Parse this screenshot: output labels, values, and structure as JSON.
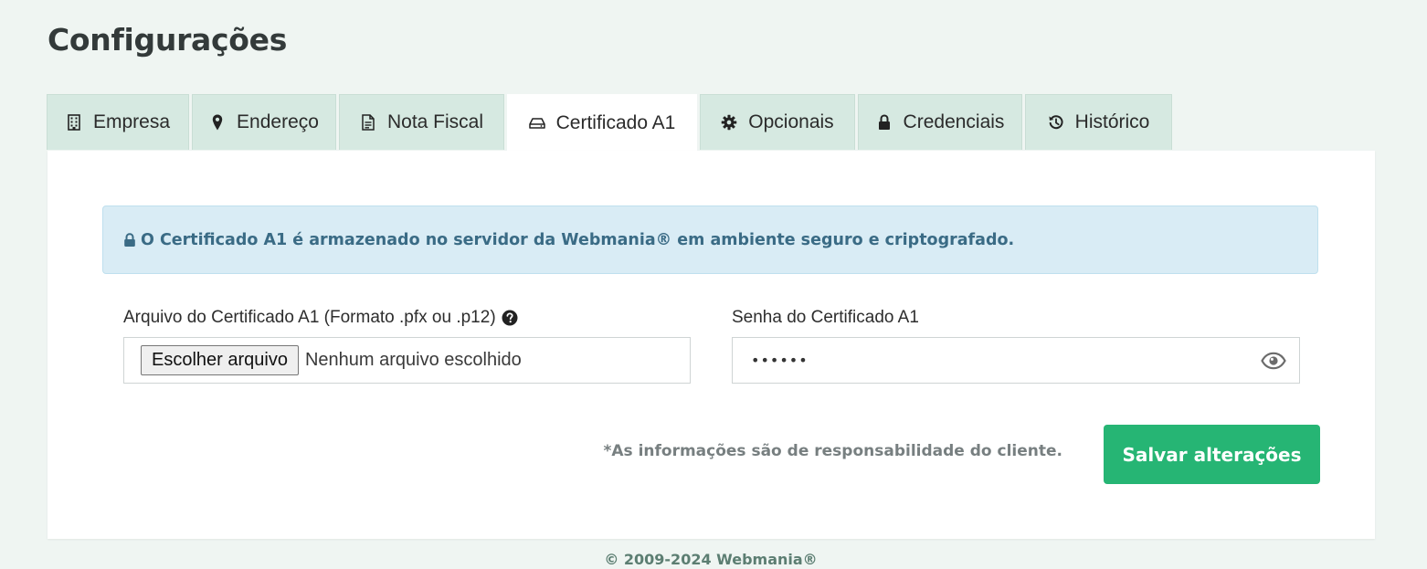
{
  "page": {
    "title": "Configurações"
  },
  "tabs": [
    {
      "label": "Empresa",
      "icon": "building-icon",
      "active": false
    },
    {
      "label": "Endereço",
      "icon": "map-marker-icon",
      "active": false
    },
    {
      "label": "Nota Fiscal",
      "icon": "document-icon",
      "active": false
    },
    {
      "label": "Certificado A1",
      "icon": "hard-drive-icon",
      "active": true
    },
    {
      "label": "Opcionais",
      "icon": "gear-icon",
      "active": false
    },
    {
      "label": "Credenciais",
      "icon": "lock-icon",
      "active": false
    },
    {
      "label": "Histórico",
      "icon": "history-icon",
      "active": false
    }
  ],
  "alert": {
    "icon": "lock-icon",
    "text": "O Certificado A1 é armazenado no servidor da Webmania® em ambiente seguro e criptografado."
  },
  "certificate_file": {
    "label": "Arquivo do Certificado A1 (Formato .pfx ou .p12)",
    "help_icon": "question-circle-icon",
    "button_label": "Escolher arquivo",
    "status": "Nenhum arquivo escolhido"
  },
  "certificate_password": {
    "label": "Senha do Certificado A1",
    "value": "••••••",
    "toggle_icon": "eye-icon"
  },
  "form_footer": {
    "disclaimer": "*As informações são de responsabilidade do cliente.",
    "save_label": "Salvar alterações"
  },
  "footer": {
    "copyright": "© 2009-2024 Webmania®"
  },
  "colors": {
    "background": "#eff5f2",
    "tab_inactive": "#d6e9e1",
    "alert_background": "#d9ecf5",
    "alert_text": "#3a6b85",
    "primary_button": "#26b574"
  }
}
